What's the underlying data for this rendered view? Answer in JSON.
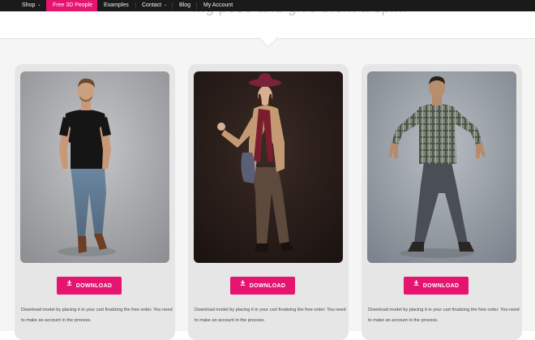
{
  "nav": {
    "items": [
      {
        "label": "Shop",
        "dropdown": true
      },
      {
        "label": "Free 3D People",
        "dropdown": false
      },
      {
        "label": "Examples",
        "dropdown": false
      },
      {
        "label": "Contact",
        "dropdown": true
      },
      {
        "label": "Blog",
        "dropdown": false
      },
      {
        "label": "My Account",
        "dropdown": false
      }
    ],
    "dropdown_icon": "chevron-down-icon"
  },
  "hero": {
    "partial_text": "...g pose and give them a spin!"
  },
  "cards": [
    {
      "photo_alt": "Man in black shirt and jeans",
      "download_label": "DOWNLOAD",
      "note": "Download model by placing it in your cart finalizing the free order. You need to make an account in the process."
    },
    {
      "photo_alt": "Woman in hat and coat",
      "download_label": "DOWNLOAD",
      "note": "Download model by placing it in your cart finalizing the free order. You need to make an account in the process."
    },
    {
      "photo_alt": "Man in plaid shirt with arms out",
      "download_label": "DOWNLOAD",
      "note": "Download model by placing it in your cart finalizing the free order. You need to make an account in the process."
    }
  ],
  "colors": {
    "accent": "#e5156f",
    "nav_bg": "#1a1a1a",
    "card_bg": "#e6e6e6",
    "page_bg": "#f5f5f5"
  }
}
